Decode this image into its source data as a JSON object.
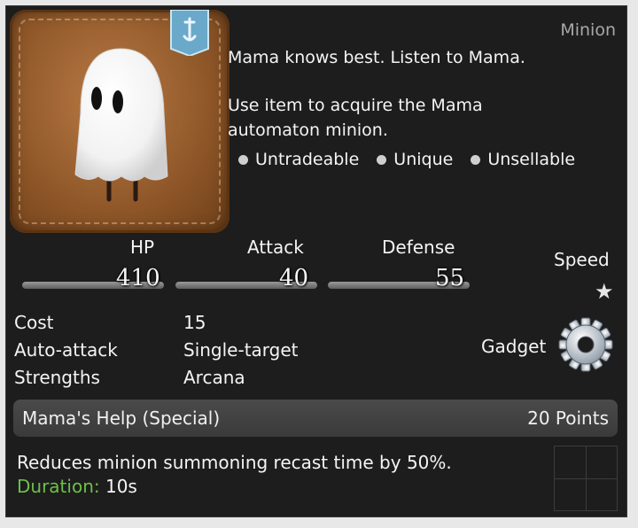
{
  "item": {
    "category": "Minion",
    "description_line": "Mama knows best. Listen to Mama.",
    "use_text_1": "Use item to acquire the Mama",
    "use_text_2": "automaton minion.",
    "flags": [
      "Untradeable",
      "Unique",
      "Unsellable"
    ]
  },
  "stats": {
    "hp": {
      "label": "HP",
      "value": "410"
    },
    "attack": {
      "label": "Attack",
      "value": "40"
    },
    "defense": {
      "label": "Defense",
      "value": "55"
    },
    "speed": {
      "label": "Speed",
      "stars": "★"
    }
  },
  "info": {
    "cost_label": "Cost",
    "cost_value": "15",
    "auto_label": "Auto-attack",
    "auto_value": "Single-target",
    "strengths_label": "Strengths",
    "strengths_value": "Arcana",
    "type_label": "Gadget",
    "type_icon": "gear-icon"
  },
  "special": {
    "name": "Mama's Help (Special)",
    "points": "20 Points",
    "description": "Reduces minion summoning recast time by 50%.",
    "duration_label": "Duration:",
    "duration_value": "10s"
  },
  "colors": {
    "background": "#1d1d1d",
    "duration_label": "#6fbf4a",
    "badge": "#6aa9c9",
    "portrait": "#8e5628"
  }
}
